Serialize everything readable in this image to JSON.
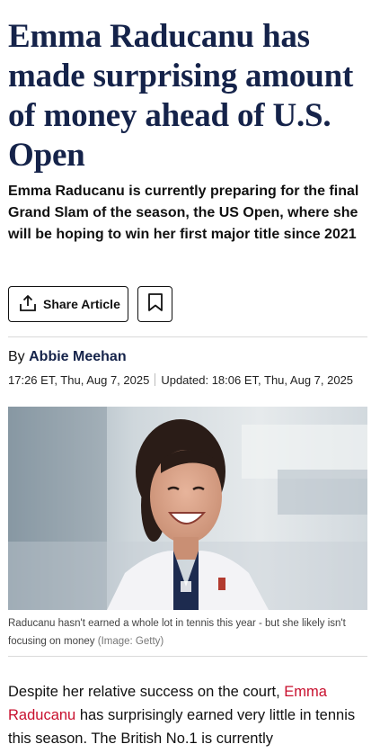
{
  "article": {
    "headline": "Emma Raducanu has made surprising amount of money ahead of U.S. Open",
    "standfirst": "Emma Raducanu is currently preparing for the final Grand Slam of the season, the US Open, where she will be hoping to win her first major title since 2021",
    "share_label": "Share Article",
    "byline_prefix": "By",
    "author": "Abbie Meehan",
    "published": "17:26 ET, Thu, Aug 7, 2025",
    "updated": "Updated: 18:06 ET, Thu, Aug 7, 2025",
    "caption": "Raducanu hasn't earned a whole lot in tennis this year - but she likely isn't focusing on money",
    "credit": "(Image: Getty)",
    "body_before_link": "Despite her relative success on the court, ",
    "body_link": "Emma Raducanu",
    "body_after_link": " has surprisingly earned very little in tennis this season. The British No.1 is currently"
  },
  "icons": {
    "share": "share-upload-icon",
    "bookmark": "bookmark-icon"
  },
  "colors": {
    "headline": "#15234a",
    "link": "#c8102e"
  }
}
